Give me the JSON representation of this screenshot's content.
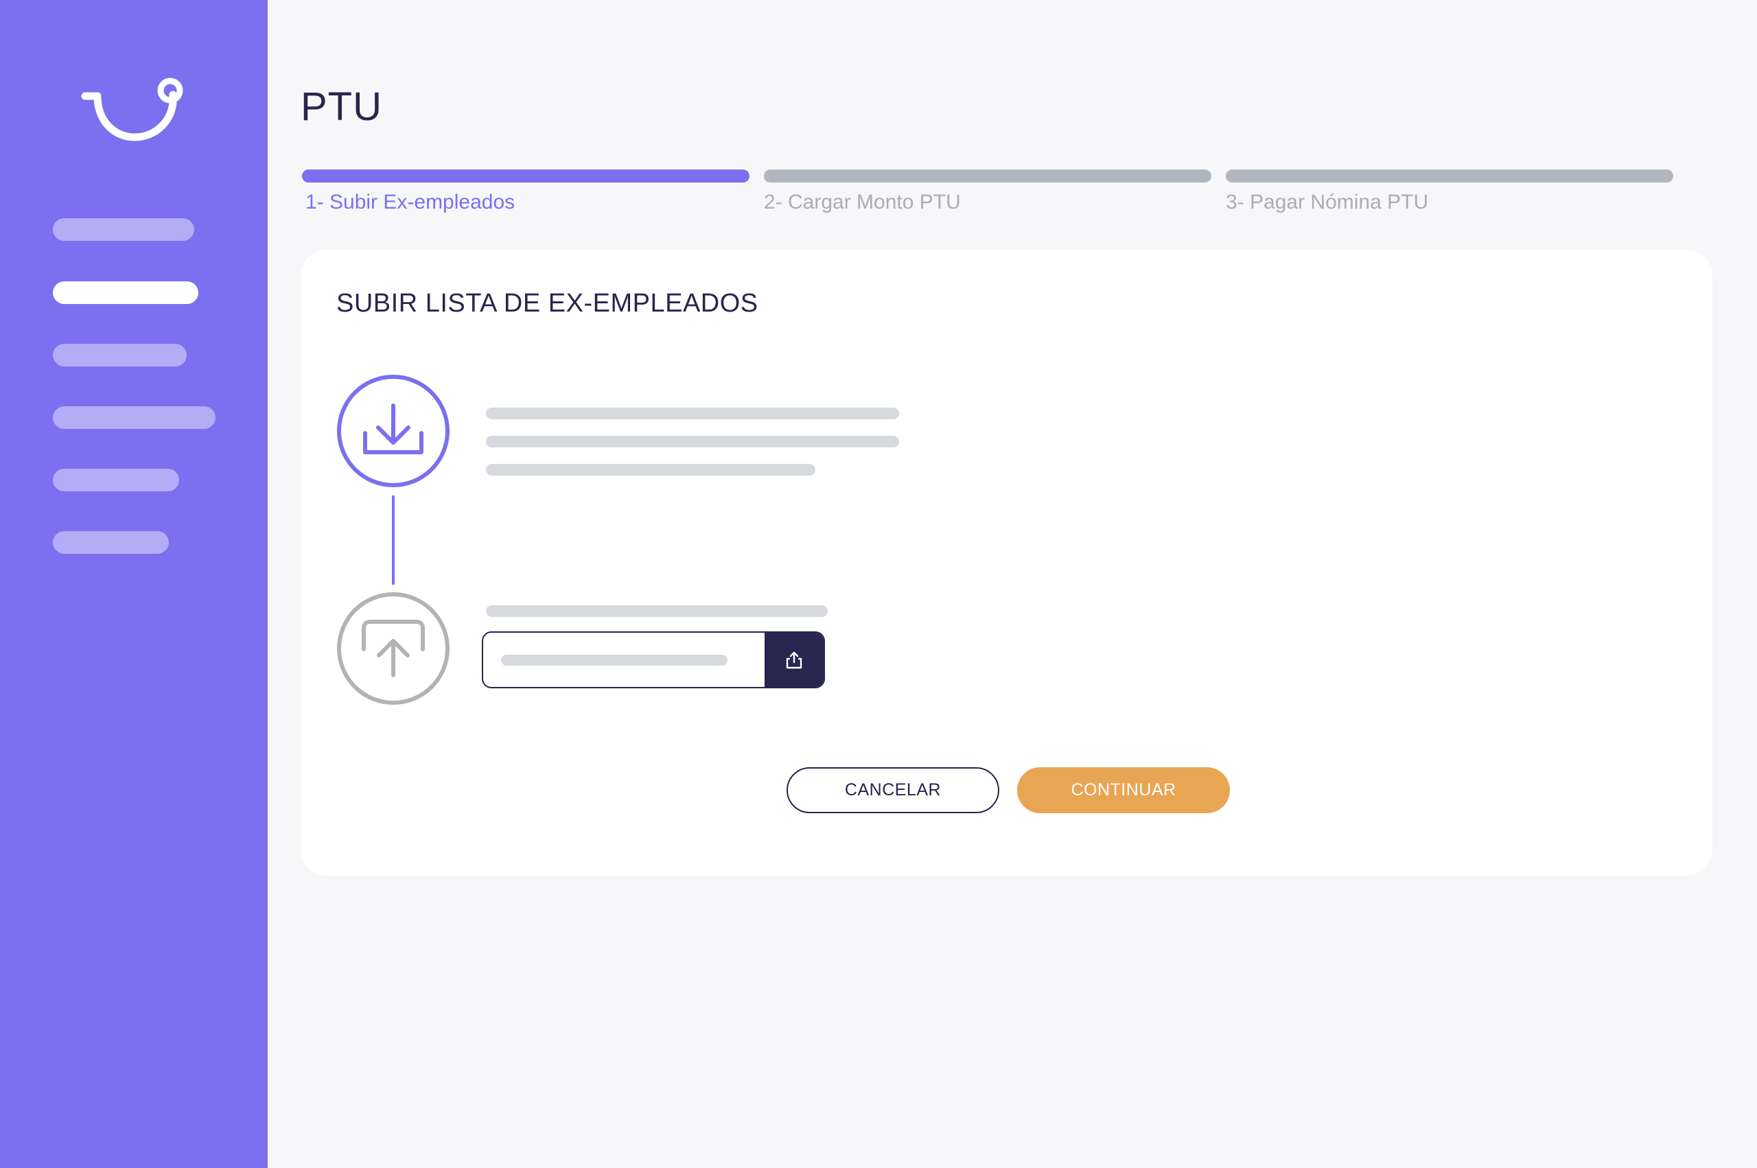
{
  "app": {
    "logo_icon": "smile-hook-logo-icon",
    "accent_color": "#7a70f0",
    "sidebar_color": "#7a70f0"
  },
  "sidebar": {
    "items": [
      {
        "state": "inactive"
      },
      {
        "state": "active"
      },
      {
        "state": "inactive"
      },
      {
        "state": "inactive"
      },
      {
        "state": "inactive"
      },
      {
        "state": "inactive"
      }
    ]
  },
  "header": {
    "title": "PTU"
  },
  "stepper": {
    "current_step": 1,
    "steps": [
      {
        "label": "1- Subir Ex-empleados",
        "state": "active"
      },
      {
        "label": "2- Cargar Monto PTU",
        "state": "pending"
      },
      {
        "label": "3- Pagar Nómina PTU",
        "state": "pending"
      }
    ]
  },
  "card": {
    "title": "SUBIR LISTA DE EX-EMPLEADOS",
    "download_step": {
      "icon": "download-icon",
      "color": "#7a70f0"
    },
    "upload_step": {
      "icon": "upload-icon",
      "color": "#b3b3b3"
    },
    "file_input": {
      "button_icon": "share-upload-icon"
    }
  },
  "actions": {
    "cancel_label": "CANCELAR",
    "continue_label": "CONTINUAR",
    "continue_color": "#e8a554"
  }
}
